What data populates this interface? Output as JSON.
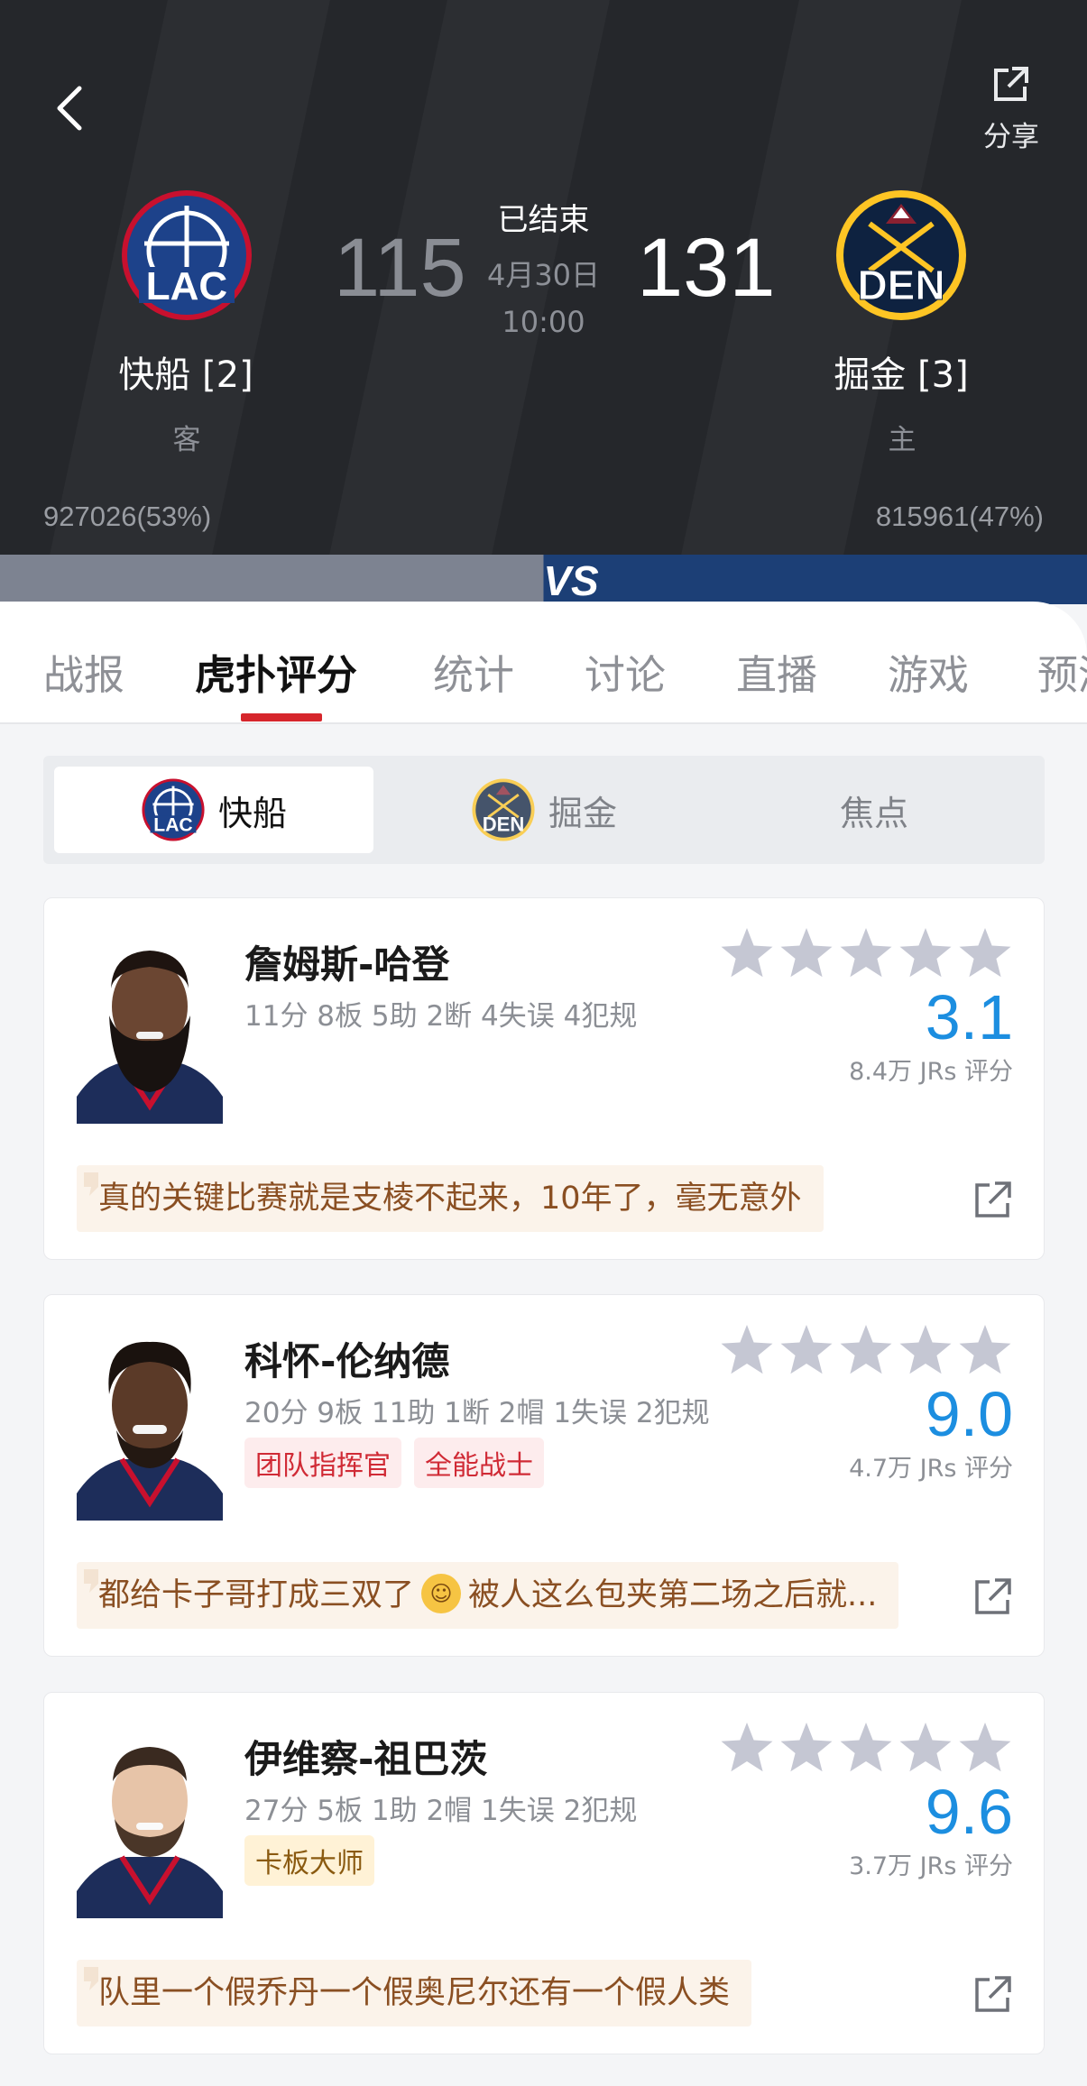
{
  "header": {
    "share_label": "分享",
    "status": "已结束",
    "date": "4月30日",
    "time": "10:00",
    "away": {
      "abbr": "LAC",
      "name": "快船 [2]",
      "role": "客",
      "score": "115",
      "votes": "927026(53%)",
      "color": "#1d428a"
    },
    "home": {
      "abbr": "DEN",
      "name": "掘金 [3]",
      "role": "主",
      "score": "131",
      "votes": "815961(47%)",
      "color": "#0e2240"
    }
  },
  "tabs": [
    "战报",
    "虎扑评分",
    "统计",
    "讨论",
    "直播",
    "游戏",
    "预测"
  ],
  "active_tab": "虎扑评分",
  "switcher": {
    "items": [
      "快船",
      "掘金",
      "焦点"
    ],
    "active": "快船"
  },
  "players": [
    {
      "name": "詹姆斯-哈登",
      "stats": "11分 8板 5助 2断 4失误 4犯规",
      "badges": [],
      "rating": "3.1",
      "rating_count": "8.4万 JRs 评分",
      "comment": "真的关键比赛就是支棱不起来，10年了，毫无意外"
    },
    {
      "name": "科怀-伦纳德",
      "stats": "20分 9板 11助 1断 2帽 1失误 2犯规",
      "badges": [
        "团队指挥官",
        "全能战士"
      ],
      "rating": "9.0",
      "rating_count": "4.7万 JRs 评分",
      "comment_before": "都给卡子哥打成三双了",
      "comment_after": "被人这么包夹第二场之后就..."
    },
    {
      "name": "伊维察-祖巴茨",
      "stats": "27分 5板 1助 2帽 1失误 2犯规",
      "badges": [
        "卡板大师"
      ],
      "rating": "9.6",
      "rating_count": "3.7万 JRs 评分",
      "comment": "队里一个假乔丹一个假奥尼尔还有一个假人类"
    }
  ],
  "colors": {
    "accent_red": "#d6262c",
    "rating_blue": "#1c8ee0",
    "star_gray": "#c5c7d3"
  }
}
